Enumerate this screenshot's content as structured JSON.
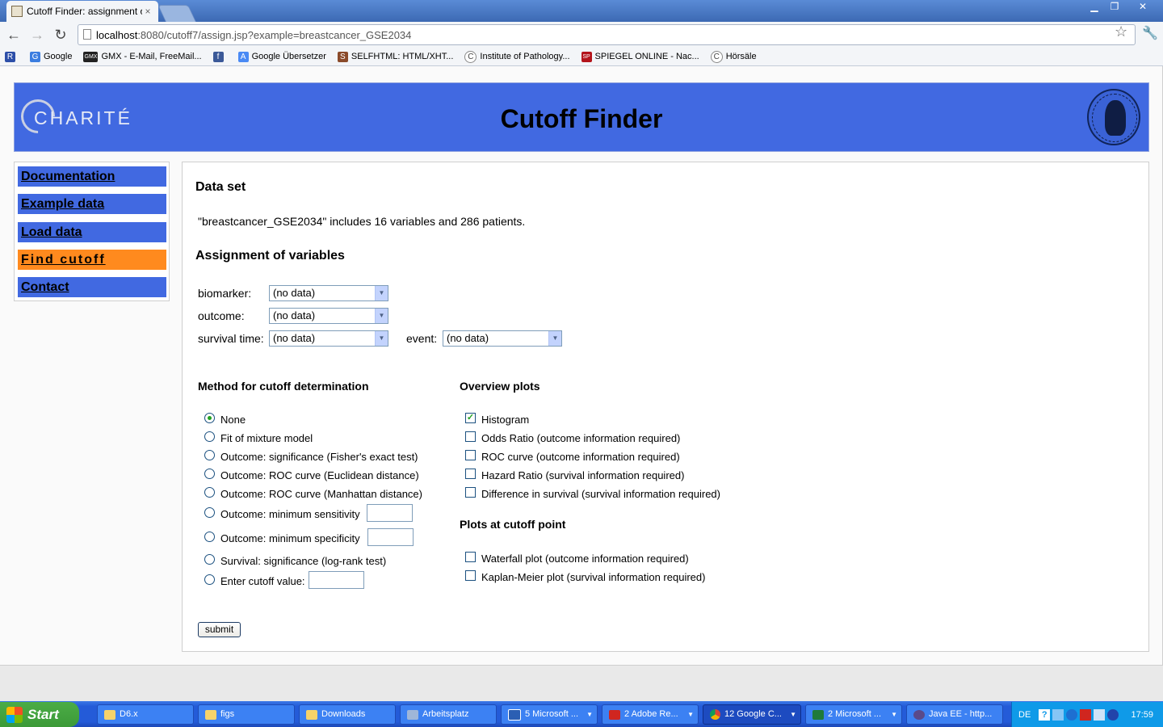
{
  "browser": {
    "tab_title": "Cutoff Finder: assignment of",
    "tab_close": "×",
    "url_host": "localhost",
    "url_rest": ":8080/cutoff7/assign.jsp?example=breastcancer_GSE2034",
    "bookmarks": [
      {
        "label": "",
        "icon": "R"
      },
      {
        "label": "Google",
        "icon": "G"
      },
      {
        "label": "GMX - E-Mail, FreeMail...",
        "icon": "GMX"
      },
      {
        "label": "",
        "icon": "f"
      },
      {
        "label": "Google Übersetzer",
        "icon": "A"
      },
      {
        "label": "SELFHTML: HTML/XHT...",
        "icon": "S"
      },
      {
        "label": "Institute of Pathology...",
        "icon": "C"
      },
      {
        "label": "SPIEGEL ONLINE - Nac...",
        "icon": "SP"
      },
      {
        "label": "Hörsäle",
        "icon": "C"
      }
    ]
  },
  "header": {
    "logo_text": "CHARITÉ",
    "title": "Cutoff Finder"
  },
  "sidebar": {
    "items": [
      {
        "label": "Documentation",
        "active": false
      },
      {
        "label": "Example data",
        "active": false
      },
      {
        "label": "Load data",
        "active": false
      },
      {
        "label": "Find cutoff",
        "active": true
      },
      {
        "label": "Contact",
        "active": false
      }
    ]
  },
  "content": {
    "dataset_heading": "Data set",
    "dataset_description": "\"breastcancer_GSE2034\" includes 16 variables and 286 patients.",
    "assignment_heading": "Assignment of variables",
    "fields": {
      "biomarker_label": "biomarker:",
      "biomarker_value": "(no data)",
      "outcome_label": "outcome:",
      "outcome_value": "(no data)",
      "survival_label": "survival time:",
      "survival_value": "(no data)",
      "event_label": "event:",
      "event_value": "(no data)"
    },
    "method_heading": "Method for cutoff determination",
    "methods": [
      {
        "label": "None",
        "checked": true
      },
      {
        "label": "Fit of mixture model",
        "checked": false
      },
      {
        "label": "Outcome: significance (Fisher's exact test)",
        "checked": false
      },
      {
        "label": "Outcome: ROC curve (Euclidean distance)",
        "checked": false
      },
      {
        "label": "Outcome: ROC curve (Manhattan distance)",
        "checked": false
      },
      {
        "label": "Outcome: minimum sensitivity",
        "checked": false
      },
      {
        "label": "Outcome: minimum specificity",
        "checked": false
      },
      {
        "label": "Survival: significance (log-rank test)",
        "checked": false
      },
      {
        "label": "Enter cutoff value:",
        "checked": false
      }
    ],
    "overview_heading": "Overview plots",
    "overview_plots": [
      {
        "label": "Histogram",
        "checked": true
      },
      {
        "label": "Odds Ratio (outcome information required)",
        "checked": false
      },
      {
        "label": "ROC curve (outcome information required)",
        "checked": false
      },
      {
        "label": "Hazard Ratio (survival information required)",
        "checked": false
      },
      {
        "label": "Difference in survival (survival information required)",
        "checked": false
      }
    ],
    "cutoff_plots_heading": "Plots at cutoff point",
    "cutoff_plots": [
      {
        "label": "Waterfall plot (outcome information required)",
        "checked": false
      },
      {
        "label": "Kaplan-Meier plot (survival information required)",
        "checked": false
      }
    ],
    "submit_label": "submit"
  },
  "taskbar": {
    "start_label": "Start",
    "tasks": [
      {
        "label": "D6.x",
        "has_menu": false,
        "active": false
      },
      {
        "label": "figs",
        "has_menu": false,
        "active": false
      },
      {
        "label": "Downloads",
        "has_menu": false,
        "active": false
      },
      {
        "label": "Arbeitsplatz",
        "has_menu": false,
        "active": false
      },
      {
        "label": "5 Microsoft ...",
        "has_menu": true,
        "active": false
      },
      {
        "label": "2 Adobe Re...",
        "has_menu": true,
        "active": false
      },
      {
        "label": "12 Google C...",
        "has_menu": true,
        "active": true
      },
      {
        "label": "2 Microsoft ...",
        "has_menu": true,
        "active": false
      },
      {
        "label": "Java EE - http...",
        "has_menu": false,
        "active": false
      }
    ],
    "language": "DE",
    "clock": "17:59"
  }
}
